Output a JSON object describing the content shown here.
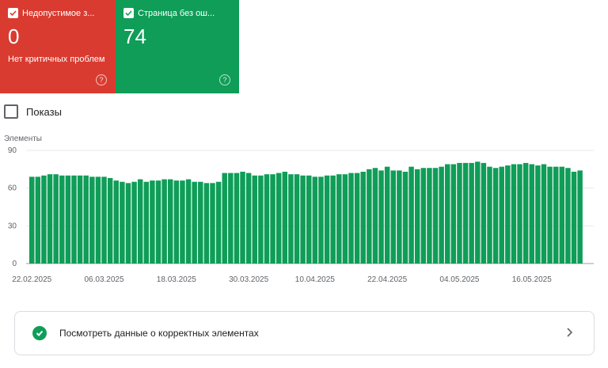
{
  "cards": {
    "invalid": {
      "label": "Недопустимое з...",
      "value": "0",
      "sub": "Нет критичных проблем",
      "help": "?"
    },
    "valid": {
      "label": "Страница без ош...",
      "value": "74",
      "help": "?"
    }
  },
  "impressions_label": "Показы",
  "footer_label": "Посмотреть данные о корректных элементах",
  "colors": {
    "red": "#d93b30",
    "green": "#0f9d58"
  },
  "chart_data": {
    "type": "bar",
    "ylabel": "Элементы",
    "ylim": [
      0,
      90
    ],
    "yticks": [
      0,
      30,
      60,
      90
    ],
    "grid": true,
    "x_tick_labels": [
      "22.02.2025",
      "06.03.2025",
      "18.03.2025",
      "30.03.2025",
      "10.04.2025",
      "22.04.2025",
      "04.05.2025",
      "16.05.2025"
    ],
    "x_tick_index": [
      0,
      12,
      24,
      36,
      47,
      59,
      71,
      83
    ],
    "series": [
      {
        "values": [
          69,
          69,
          70,
          71,
          71,
          70,
          70,
          70,
          70,
          70,
          69,
          69,
          69,
          68,
          66,
          65,
          64,
          65,
          67,
          65,
          66,
          66,
          67,
          67,
          66,
          66,
          67,
          65,
          65,
          64,
          64,
          65,
          72,
          72,
          72,
          73,
          72,
          70,
          70,
          71,
          71,
          72,
          73,
          71,
          71,
          70,
          70,
          69,
          69,
          70,
          70,
          71,
          71,
          72,
          72,
          73,
          75,
          76,
          74,
          77,
          74,
          74,
          73,
          77,
          75,
          76,
          76,
          76,
          77,
          79,
          79,
          80,
          80,
          80,
          81,
          80,
          77,
          76,
          77,
          78,
          79,
          79,
          80,
          79,
          78,
          79,
          77,
          77,
          77,
          76,
          73,
          74
        ]
      }
    ]
  }
}
